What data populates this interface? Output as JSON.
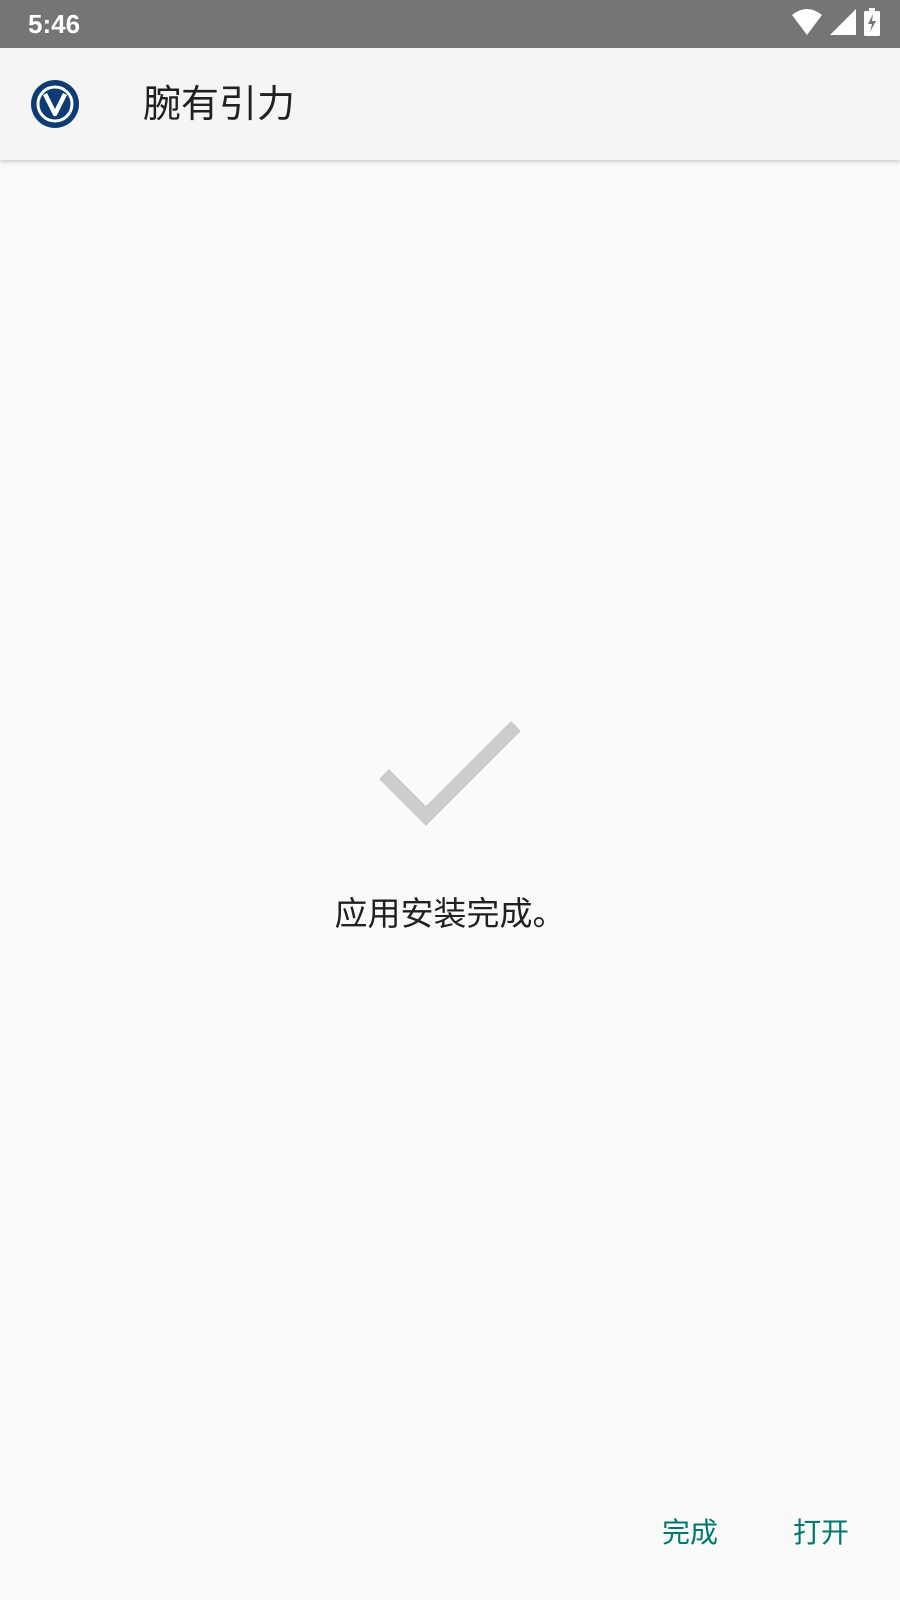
{
  "status_bar": {
    "time": "5:46",
    "icons": [
      "wifi-icon",
      "cellular-signal-icon",
      "battery-charging-icon"
    ]
  },
  "app_bar": {
    "app_icon": "app-logo-icon",
    "title": "腕有引力"
  },
  "main": {
    "status_icon": "checkmark-icon",
    "message": "应用安装完成。"
  },
  "actions": {
    "done_label": "完成",
    "open_label": "打开"
  },
  "colors": {
    "status_bar": "#757575",
    "app_bar": "#f5f5f5",
    "background": "#fafafa",
    "accent": "#00796b",
    "checkmark": "#cccccc",
    "logo": "#0d3b73"
  }
}
